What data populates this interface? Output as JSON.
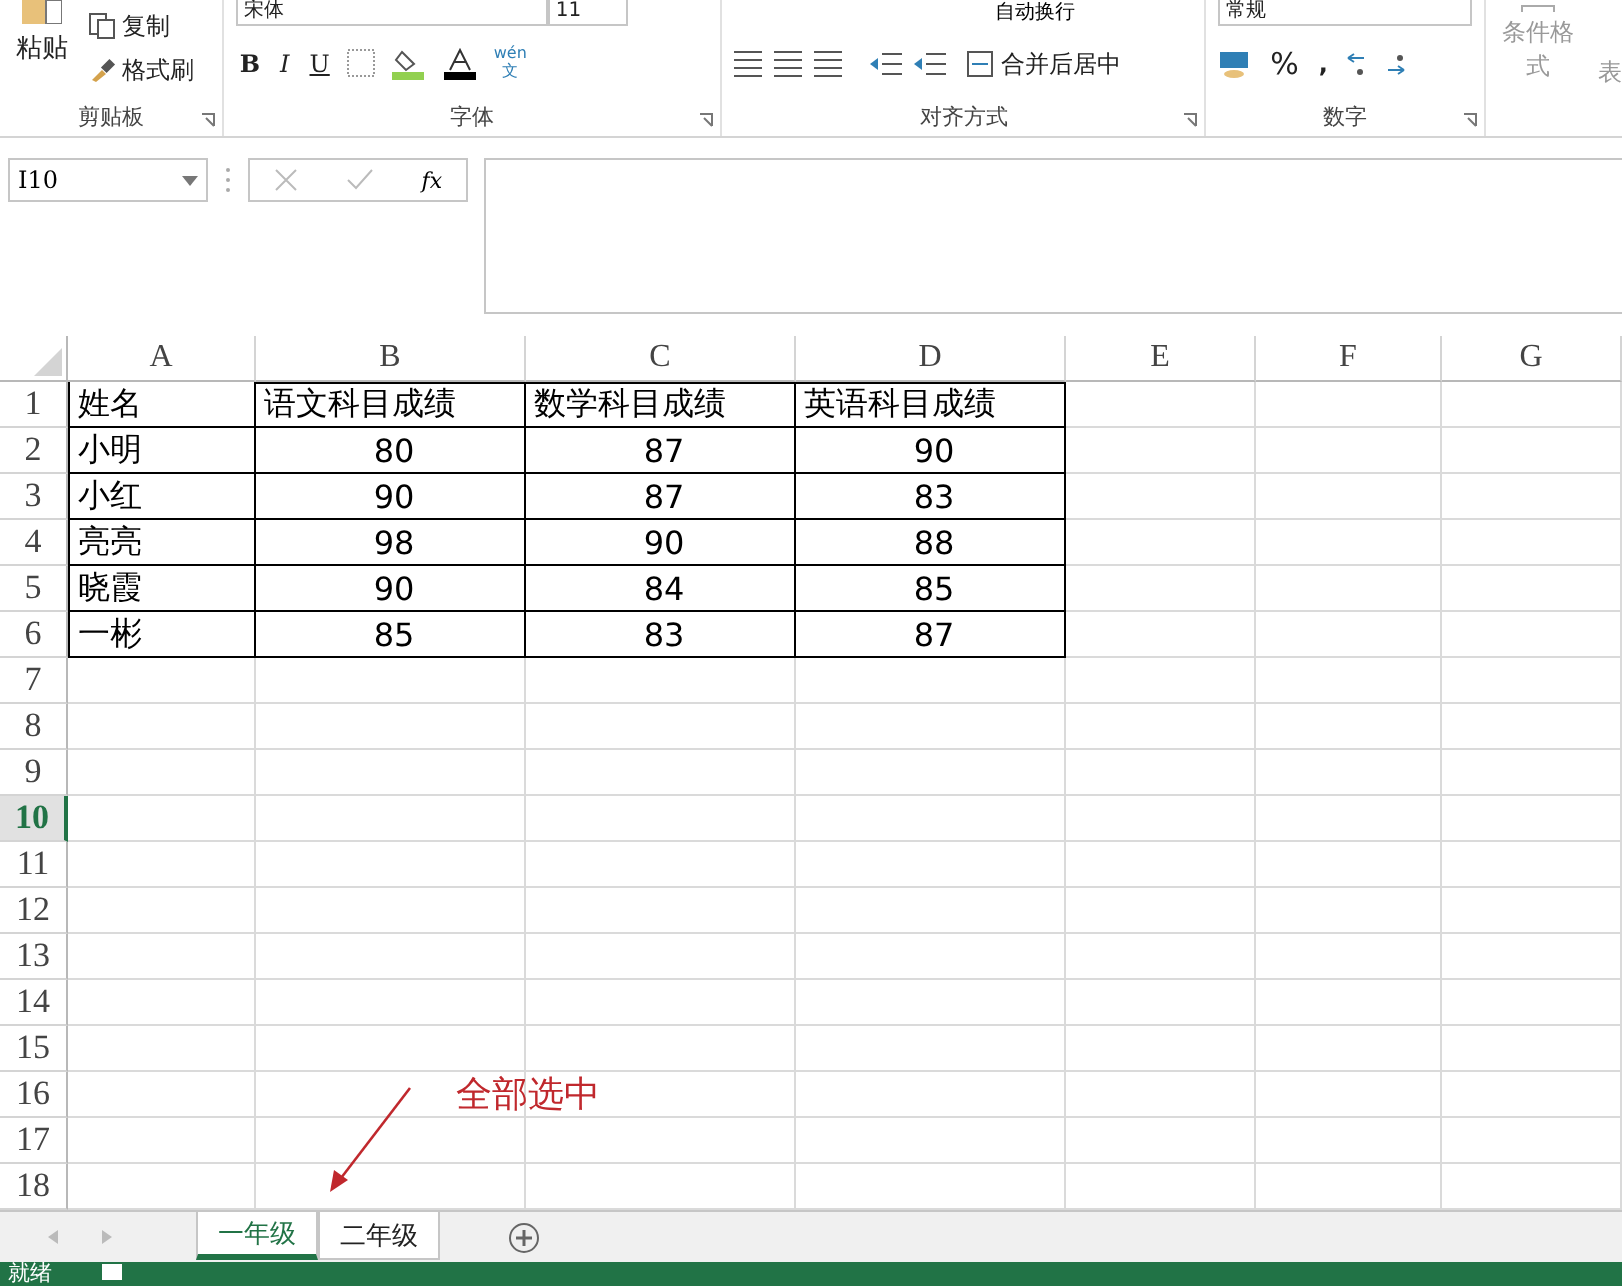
{
  "ribbon": {
    "clipboard": {
      "paste": "粘贴",
      "copy": "复制",
      "format_painter": "格式刷",
      "label": "剪贴板"
    },
    "font": {
      "font_name": "宋体",
      "font_size": "11",
      "bold": "B",
      "italic": "I",
      "underline": "U",
      "phonetic_top": "wén",
      "phonetic_bottom": "文",
      "label": "字体"
    },
    "alignment": {
      "wrap": "自动换行",
      "merge": "合并后居中",
      "label": "对齐方式"
    },
    "number": {
      "format": "常规",
      "percent": "%",
      "comma": ",",
      "label": "数字"
    },
    "styles": {
      "conditional": "条件格式",
      "table_partial": "表"
    }
  },
  "formula_bar": {
    "name_box": "I10",
    "fx": "fx"
  },
  "sheet": {
    "columns": [
      {
        "label": "A",
        "selected": false
      },
      {
        "label": "B",
        "selected": false
      },
      {
        "label": "C",
        "selected": false
      },
      {
        "label": "D",
        "selected": false
      },
      {
        "label": "E",
        "selected": false
      },
      {
        "label": "F",
        "selected": false
      },
      {
        "label": "G",
        "selected": false
      }
    ],
    "rows": [
      {
        "label": "1",
        "selected": false,
        "cells": [
          "姓名",
          "语文科目成绩",
          "数学科目成绩",
          "英语科目成绩"
        ]
      },
      {
        "label": "2",
        "selected": false,
        "cells": [
          "小明",
          "80",
          "87",
          "90"
        ]
      },
      {
        "label": "3",
        "selected": false,
        "cells": [
          "小红",
          "90",
          "87",
          "83"
        ]
      },
      {
        "label": "4",
        "selected": false,
        "cells": [
          "亮亮",
          "98",
          "90",
          "88"
        ]
      },
      {
        "label": "5",
        "selected": false,
        "cells": [
          "晓霞",
          "90",
          "84",
          "85"
        ]
      },
      {
        "label": "6",
        "selected": false,
        "cells": [
          "一彬",
          "85",
          "83",
          "87"
        ]
      },
      {
        "label": "7",
        "selected": false,
        "cells": []
      },
      {
        "label": "8",
        "selected": false,
        "cells": []
      },
      {
        "label": "9",
        "selected": false,
        "cells": []
      },
      {
        "label": "10",
        "selected": true,
        "cells": []
      },
      {
        "label": "11",
        "selected": false,
        "cells": []
      },
      {
        "label": "12",
        "selected": false,
        "cells": []
      },
      {
        "label": "13",
        "selected": false,
        "cells": []
      },
      {
        "label": "14",
        "selected": false,
        "cells": []
      },
      {
        "label": "15",
        "selected": false,
        "cells": []
      },
      {
        "label": "16",
        "selected": false,
        "cells": []
      },
      {
        "label": "17",
        "selected": false,
        "cells": []
      },
      {
        "label": "18",
        "selected": false,
        "cells": []
      }
    ]
  },
  "annotation": "全部选中",
  "sheet_tabs": [
    {
      "label": "一年级",
      "selected": true
    },
    {
      "label": "二年级",
      "selected": false
    }
  ],
  "status_bar": {
    "status": "就绪"
  }
}
